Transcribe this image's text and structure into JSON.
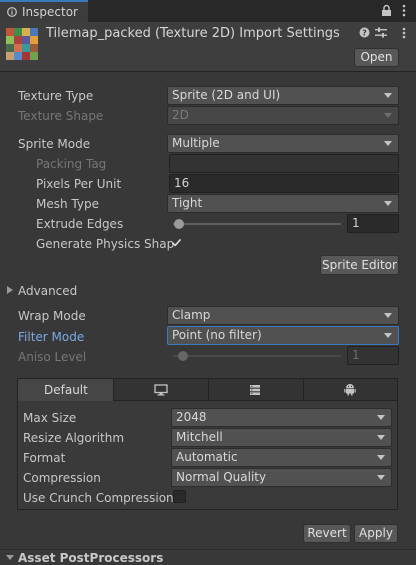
{
  "tab": {
    "label": "Inspector"
  },
  "header": {
    "title": "Tilemap_packed (Texture 2D) Import Settings",
    "open_label": "Open"
  },
  "fields": {
    "texture_type": {
      "label": "Texture Type",
      "value": "Sprite (2D and UI)"
    },
    "texture_shape": {
      "label": "Texture Shape",
      "value": "2D"
    },
    "sprite_mode": {
      "label": "Sprite Mode",
      "value": "Multiple"
    },
    "packing_tag": {
      "label": "Packing Tag",
      "value": ""
    },
    "pixels_per_unit": {
      "label": "Pixels Per Unit",
      "value": "16"
    },
    "mesh_type": {
      "label": "Mesh Type",
      "value": "Tight"
    },
    "extrude_edges": {
      "label": "Extrude Edges",
      "value": "1"
    },
    "generate_physics_shape": {
      "label": "Generate Physics Shap",
      "checked": true
    },
    "sprite_editor_label": "Sprite Editor",
    "advanced_label": "Advanced",
    "wrap_mode": {
      "label": "Wrap Mode",
      "value": "Clamp"
    },
    "filter_mode": {
      "label": "Filter Mode",
      "value": "Point (no filter)"
    },
    "aniso_level": {
      "label": "Aniso Level",
      "value": "1"
    }
  },
  "platform": {
    "tabs": [
      {
        "label": "Default",
        "icon": null
      },
      {
        "label": "",
        "icon": "monitor-icon"
      },
      {
        "label": "",
        "icon": "server-icon"
      },
      {
        "label": "",
        "icon": "android-icon"
      }
    ],
    "max_size": {
      "label": "Max Size",
      "value": "2048"
    },
    "resize_algorithm": {
      "label": "Resize Algorithm",
      "value": "Mitchell"
    },
    "format": {
      "label": "Format",
      "value": "Automatic"
    },
    "compression": {
      "label": "Compression",
      "value": "Normal Quality"
    },
    "crunch": {
      "label": "Use Crunch Compression",
      "checked": false
    }
  },
  "footer": {
    "revert_label": "Revert",
    "apply_label": "Apply",
    "next_section": "Asset PostProcessors"
  },
  "colors": {
    "accent": "#3a79bb",
    "panel": "#383838",
    "link_label": "#7ca9e6"
  }
}
